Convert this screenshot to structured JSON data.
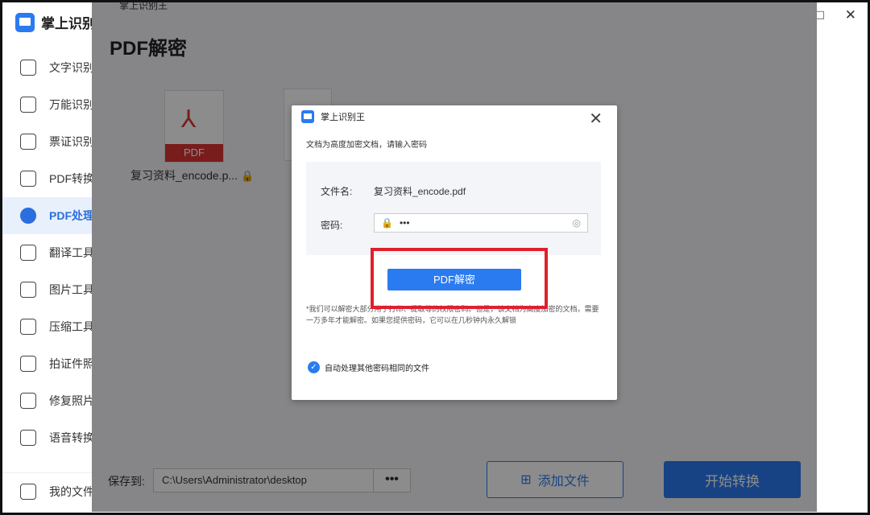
{
  "app": {
    "title": "掌上识别王"
  },
  "sidebar": {
    "items": [
      {
        "label": "文字识别",
        "icon": "text-recognition-icon"
      },
      {
        "label": "万能识别",
        "icon": "universal-scan-icon"
      },
      {
        "label": "票证识别",
        "icon": "ticket-icon"
      },
      {
        "label": "PDF转换",
        "icon": "pdf-convert-icon"
      },
      {
        "label": "PDF处理",
        "icon": "pdf-process-icon",
        "active": true
      },
      {
        "label": "翻译工具",
        "icon": "translate-icon"
      },
      {
        "label": "图片工具",
        "icon": "image-icon"
      },
      {
        "label": "压缩工具",
        "icon": "compress-icon"
      },
      {
        "label": "拍证件照",
        "icon": "id-photo-icon"
      },
      {
        "label": "修复照片",
        "icon": "repair-photo-icon"
      },
      {
        "label": "语音转换",
        "icon": "voice-icon"
      }
    ],
    "bottom": {
      "label": "我的文件"
    }
  },
  "window_controls": {
    "minimize": "—",
    "maximize": "□",
    "close": "✕"
  },
  "inner_window": {
    "title": "掌上识别王"
  },
  "page": {
    "title": "PDF解密"
  },
  "file": {
    "name": "复习资料_encode.p...",
    "type_label": "PDF"
  },
  "bottom_bar": {
    "save_label": "保存到:",
    "path": "C:\\Users\\Administrator\\desktop",
    "browse": "•••",
    "add_file": "添加文件",
    "start": "开始转换"
  },
  "dialog": {
    "title": "掌上识别王",
    "message": "文档为高度加密文档，请输入密码",
    "file_label": "文件名:",
    "file_value": "复习资料_encode.pdf",
    "password_label": "密码:",
    "password_value": "•••",
    "decrypt_button": "PDF解密",
    "note": "*我们可以解密大部分用于打印、提取等的权限密码。但是，该文档为高度加密的文档，需要一万多年才能解密。如果您提供密码，它可以在几秒钟内永久解锁",
    "checkbox_label": "自动处理其他密码相同的文件",
    "checkbox_checked": true
  }
}
